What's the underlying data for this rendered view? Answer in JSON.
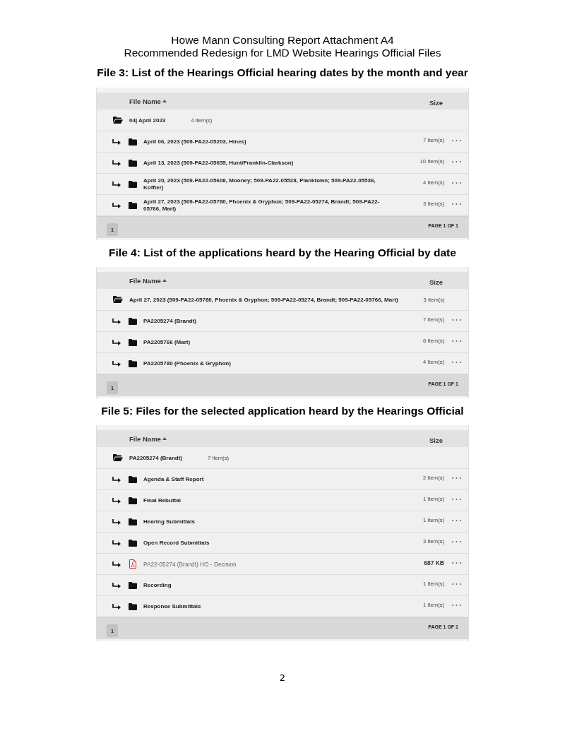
{
  "document": {
    "header_lines": [
      "Howe Mann Consulting Report Attachment A4",
      "Recommended Redesign for LMD Website Hearings Official Files"
    ],
    "page_number": "2"
  },
  "sections": [
    {
      "caption": "File 3: List of the Hearings Official hearing dates by the month and year",
      "file_list": {
        "columns": [
          {
            "label": "File Name",
            "sorted": true
          },
          {
            "label": "Size",
            "sorted": false
          }
        ],
        "parent": {
          "name": "04| April 2023",
          "count": "4 Item(s)"
        },
        "rows": [
          {
            "kind": "folder",
            "name": "April 06, 2023 (509-PA22-05203, Hines)",
            "size": "7 Item(s)"
          },
          {
            "kind": "folder",
            "name": "April 13, 2023 (509-PA22-05655, Hunt/Franklin-Clarkson)",
            "size": "10 Item(s)"
          },
          {
            "kind": "folder",
            "name": "April 20, 2023 (509-PA22-05608, Mooney; 509-PA22-05528, Planktown; 509-PA22-05536, Koffler)",
            "size": "4 Item(s)"
          },
          {
            "kind": "folder",
            "name": "April 27, 2023 (509-PA22-05780, Phoenix & Gryphon; 509-PA22-05274, Brandt; 509-PA22-05766, Mart)",
            "size": "3 Item(s)"
          }
        ],
        "pagination": {
          "pages": [
            {
              "label": "1",
              "selected": true
            }
          ],
          "summary": "PAGE 1 OF 1"
        }
      }
    },
    {
      "caption": "File 4: List of the applications heard by the Hearing Official by date",
      "file_list": {
        "columns": [
          {
            "label": "File Name",
            "sorted": true
          },
          {
            "label": "Size",
            "sorted": false
          }
        ],
        "parent": {
          "name": "April 27, 2023 (509-PA22-05780, Phoenix & Gryphon; 509-PA22-05274, Brandt; 509-PA22-05766, Mart)",
          "count": "3 Item(s)"
        },
        "rows": [
          {
            "kind": "folder",
            "name": "PA2205274 (Brandt)",
            "size": "7 Item(s)"
          },
          {
            "kind": "folder",
            "name": "PA2205766 (Mart)",
            "size": "6 Item(s)"
          },
          {
            "kind": "folder",
            "name": "PA2205780 (Phoenix & Gryphon)",
            "size": "4 Item(s)"
          }
        ],
        "pagination": {
          "pages": [
            {
              "label": "1",
              "selected": true
            }
          ],
          "summary": "PAGE 1 OF 1"
        }
      }
    },
    {
      "caption": "File 5: Files for the selected application heard by the Hearings Official",
      "file_list": {
        "columns": [
          {
            "label": "File Name",
            "sorted": true
          },
          {
            "label": "Size",
            "sorted": false
          }
        ],
        "parent": {
          "name": "PA2205274 (Brandt)",
          "count": "7 Item(s)"
        },
        "rows": [
          {
            "kind": "folder",
            "name": "Agenda & Staff Report",
            "size": "2 Item(s)"
          },
          {
            "kind": "folder",
            "name": "Final Rebuttal",
            "size": "1 Item(s)"
          },
          {
            "kind": "folder",
            "name": "Hearing Submittals",
            "size": "1 Item(s)"
          },
          {
            "kind": "folder",
            "name": "Open Record Submittals",
            "size": "3 Item(s)"
          },
          {
            "kind": "pdf",
            "name": "PA22-05274 (Brandt) HO - Decision",
            "size": "687 KB"
          },
          {
            "kind": "folder",
            "name": "Recording",
            "size": "1 Item(s)"
          },
          {
            "kind": "folder",
            "name": "Response Submittals",
            "size": "1 Item(s)"
          }
        ],
        "pagination": {
          "pages": [
            {
              "label": "1",
              "selected": true
            }
          ],
          "summary": "PAGE 1 OF 1"
        }
      }
    }
  ]
}
